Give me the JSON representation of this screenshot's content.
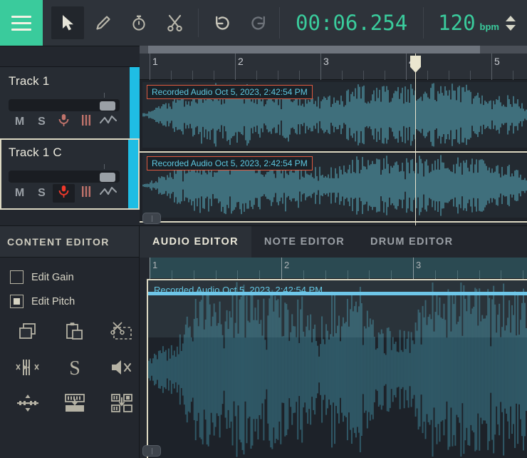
{
  "toolbar": {
    "menu_label": "menu",
    "tools": [
      {
        "name": "select-tool",
        "icon": "cursor-arrow-icon",
        "active": true
      },
      {
        "name": "draw-tool",
        "icon": "pencil-icon",
        "active": false
      },
      {
        "name": "timestretch-tool",
        "icon": "stopwatch-icon",
        "active": false
      },
      {
        "name": "split-tool",
        "icon": "scissors-icon",
        "active": false
      }
    ],
    "history": [
      {
        "name": "undo-button",
        "icon": "undo-arrow-icon",
        "enabled": true
      },
      {
        "name": "redo-button",
        "icon": "redo-arrow-icon",
        "enabled": false
      }
    ],
    "time": "00:06.254",
    "tempo": "120",
    "tempo_unit": "bpm"
  },
  "colors": {
    "accent_green": "#3acb9c",
    "track_color": "#1fbde4",
    "clip_outline": "#e05a40",
    "selection_outline": "#ddd9c3",
    "waveform": "#3f6f7c",
    "gain_line": "#6ec6e8"
  },
  "arrangement": {
    "ruler_bars": [
      "1",
      "2",
      "3",
      "4",
      "5"
    ],
    "playhead_bar": "4",
    "tracks": [
      {
        "name": "Track 1",
        "selected": false,
        "mute_label": "M",
        "solo_label": "S",
        "record_armed": false,
        "volume_percent": 82,
        "buttons": [
          "mute-button",
          "solo-button",
          "record-arm-button",
          "midi-button",
          "automation-button"
        ],
        "clip_title": "Recorded Audio Oct 5, 2023, 2:42:54 PM"
      },
      {
        "name": "Track 1 C",
        "selected": true,
        "mute_label": "M",
        "solo_label": "S",
        "record_armed": true,
        "volume_percent": 82,
        "buttons": [
          "mute-button",
          "solo-button",
          "record-arm-button",
          "midi-button",
          "automation-button"
        ],
        "clip_title": "Recorded Audio Oct 5, 2023, 2:42:54 PM"
      }
    ]
  },
  "content_editor": {
    "title": "CONTENT EDITOR",
    "checkboxes": [
      {
        "label": "Edit Gain",
        "checked": false,
        "name": "edit-gain-checkbox"
      },
      {
        "label": "Edit Pitch",
        "checked": true,
        "name": "edit-pitch-checkbox"
      }
    ],
    "tools": [
      {
        "name": "copy-button",
        "icon": "copy-icon"
      },
      {
        "name": "paste-button",
        "icon": "clipboard-paste-icon"
      },
      {
        "name": "cut-selection-button",
        "icon": "scissors-dashed-icon"
      },
      {
        "name": "remove-transient-button",
        "icon": "transient-remove-icon"
      },
      {
        "name": "snap-button",
        "icon": "s-letter-icon"
      },
      {
        "name": "mute-selection-button",
        "icon": "speaker-mute-icon"
      },
      {
        "name": "adjust-levels-button",
        "icon": "levels-slider-icon"
      },
      {
        "name": "bounce-button",
        "icon": "bounce-down-icon"
      },
      {
        "name": "consolidate-button",
        "icon": "consolidate-down-icon"
      }
    ]
  },
  "editor": {
    "tabs": [
      {
        "label": "AUDIO EDITOR",
        "active": true,
        "name": "tab-audio-editor"
      },
      {
        "label": "NOTE EDITOR",
        "active": false,
        "name": "tab-note-editor"
      },
      {
        "label": "DRUM EDITOR",
        "active": false,
        "name": "tab-drum-editor"
      }
    ],
    "ruler_bars": [
      "1",
      "2",
      "3"
    ],
    "clip_title": "Recorded Audio Oct 5, 2023, 2:42:54 PM"
  }
}
